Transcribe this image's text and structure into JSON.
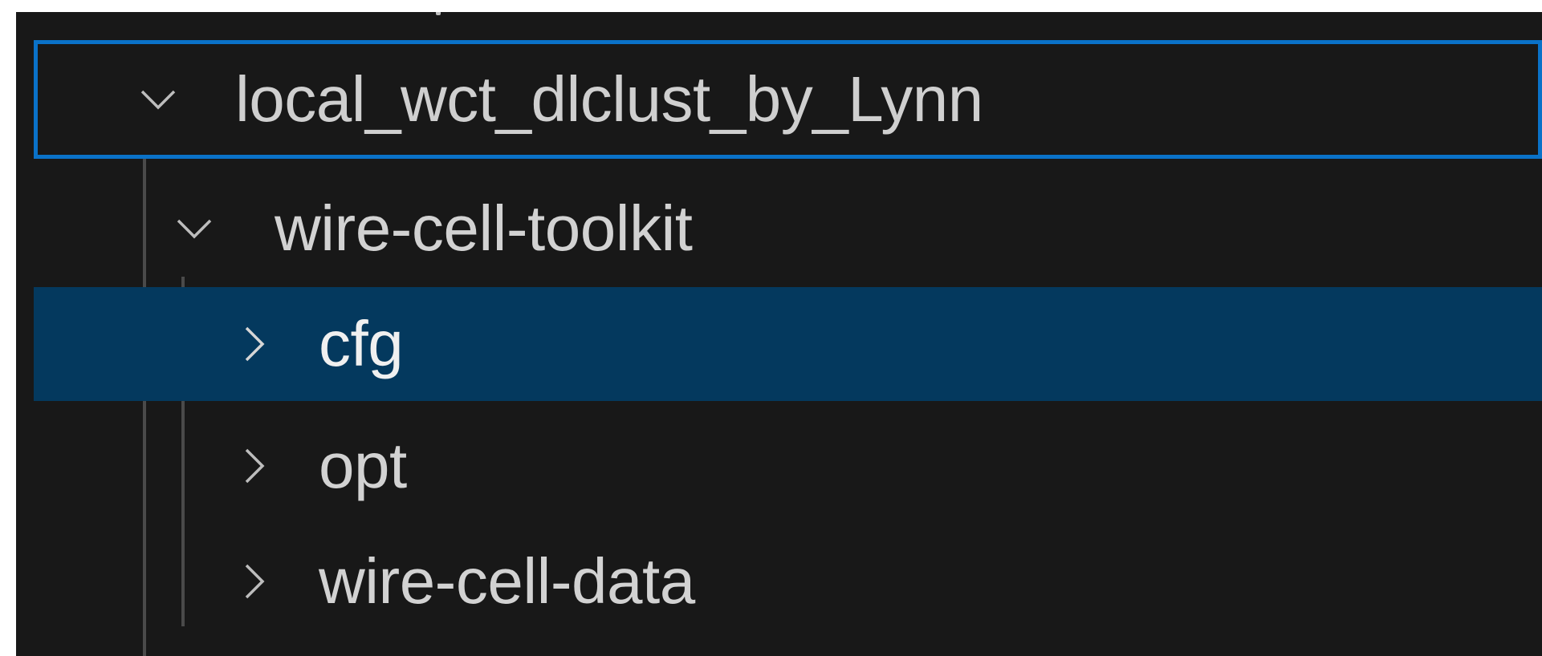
{
  "explorer": {
    "items": [
      {
        "label": "local_wct_dlclust_by_Lynn",
        "chevron": "chevron-down-icon",
        "state": "expanded",
        "focused": true
      },
      {
        "label": "wire-cell-toolkit",
        "chevron": "chevron-down-icon",
        "state": "expanded"
      },
      {
        "label": "cfg",
        "chevron": "chevron-right-icon",
        "state": "collapsed",
        "selected": true
      },
      {
        "label": "opt",
        "chevron": "chevron-right-icon",
        "state": "collapsed"
      },
      {
        "label": "wire-cell-data",
        "chevron": "chevron-right-icon",
        "state": "collapsed"
      }
    ]
  },
  "colors": {
    "background": "#181818",
    "focus_border": "#0a72c8",
    "selection": "#04395e",
    "text": "#cccccc",
    "indent_guide": "#4a4a4a"
  }
}
